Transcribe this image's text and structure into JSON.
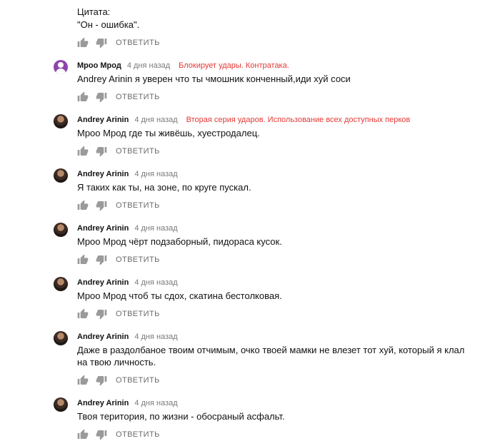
{
  "quote": {
    "line1": "Цитата:",
    "line2": "\"Он - ошибка\"."
  },
  "reply_label": "ОТВЕТИТЬ",
  "colors": {
    "annotation": "#e53935",
    "avatar_purple": "#8e44ad"
  },
  "comments": [
    {
      "author": "Мроо Мрод",
      "time": "4 дня назад",
      "note": "Блокирует удары. Контратака.",
      "text": "Andrey Arinin я уверен что ты чмошник конченный,иди хуй соси"
    },
    {
      "author": "Andrey Arinin",
      "time": "4 дня назад",
      "note": "Вторая серия ударов. Использование всех доступных перков",
      "text": "Мроо Мрод где ты живёшь, хуестродалец."
    },
    {
      "author": "Andrey Arinin",
      "time": "4 дня назад",
      "note": "",
      "text": "Я таких как ты, на зоне, по круге пускал."
    },
    {
      "author": "Andrey Arinin",
      "time": "4 дня назад",
      "note": "",
      "text": "Мроо Мрод чёрт подзаборный, пидораса кусок."
    },
    {
      "author": "Andrey Arinin",
      "time": "4 дня назад",
      "note": "",
      "text": "Мроо Мрод чтоб ты сдох, скатина бестолковая."
    },
    {
      "author": "Andrey Arinin",
      "time": "4 дня назад",
      "note": "",
      "text": "Даже в раздолбаное твоим отчимым, очко твоей мамки не влезет тот хуй, который я клал на твою личность."
    },
    {
      "author": "Andrey Arinin",
      "time": "4 дня назад",
      "note": "",
      "text": "Твоя територия, по жизни - обосраный асфальт."
    }
  ]
}
